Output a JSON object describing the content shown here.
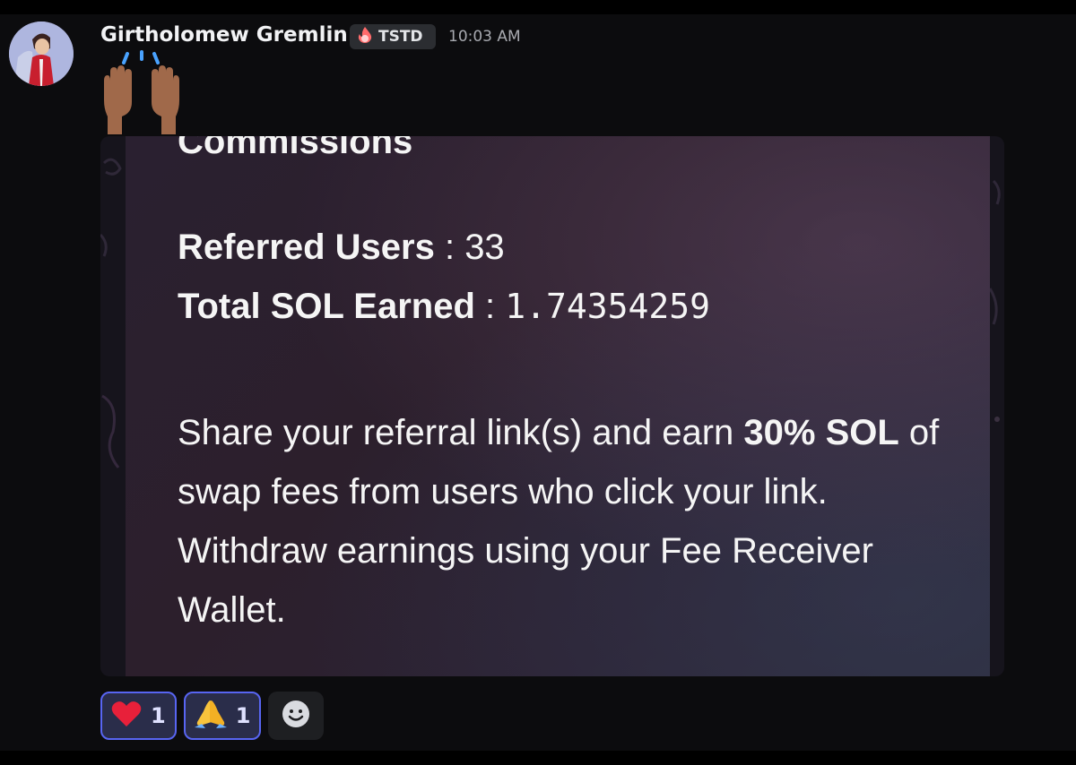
{
  "message": {
    "author": "Girtholomew Gremlin",
    "tag": "TSTD",
    "timestamp": "10:03 AM",
    "emoji": "raising-hands"
  },
  "image": {
    "heading_partial": "Commissions",
    "referred_label": "Referred Users",
    "referred_value": "33",
    "earned_label": "Total SOL Earned",
    "earned_value": "1.74354259",
    "separator": ":",
    "body_part1": "Share your referral link(s) and earn ",
    "body_bold": "30% SOL",
    "body_part2": " of swap fees from users who click your link. Withdraw earnings using your Fee Receiver Wallet."
  },
  "reactions": [
    {
      "emoji": "heart",
      "count": "1"
    },
    {
      "emoji": "folded-hands",
      "count": "1"
    }
  ],
  "icons": {
    "add_reaction": "smiley-icon",
    "tag_icon": "fire-icon"
  }
}
